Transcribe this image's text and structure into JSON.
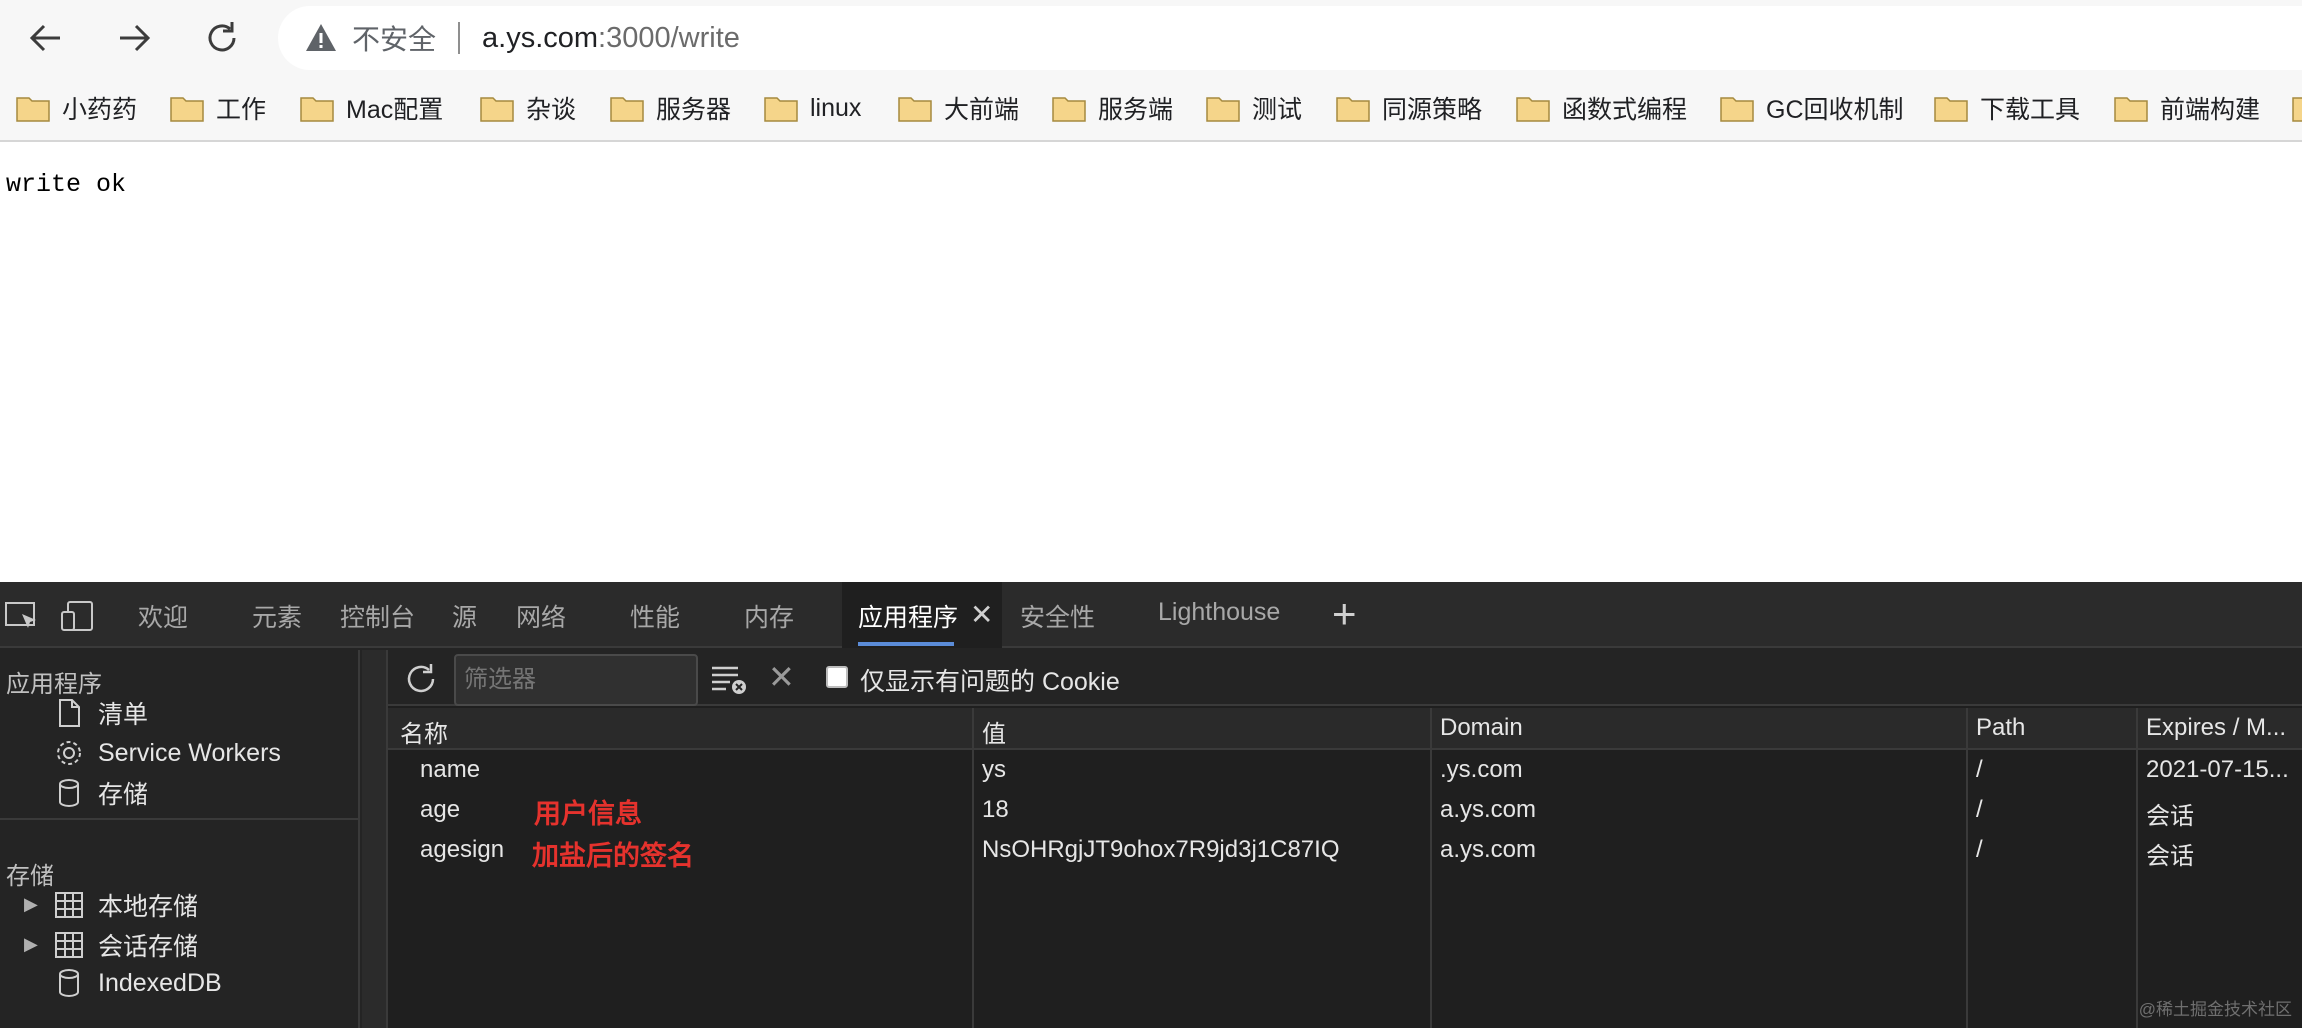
{
  "browser": {
    "security_label": "不安全",
    "url_host": "a.ys.com",
    "url_rest": ":3000/write",
    "icons": [
      "back-arrow-icon",
      "forward-arrow-icon",
      "reload-icon",
      "warning-icon",
      "folder-icon"
    ]
  },
  "bookmarks": [
    {
      "label": "小药药"
    },
    {
      "label": "工作"
    },
    {
      "label": "Mac配置"
    },
    {
      "label": "杂谈"
    },
    {
      "label": "服务器"
    },
    {
      "label": "linux"
    },
    {
      "label": "大前端"
    },
    {
      "label": "服务端"
    },
    {
      "label": "测试"
    },
    {
      "label": "同源策略"
    },
    {
      "label": "函数式编程"
    },
    {
      "label": "GC回收机制"
    },
    {
      "label": "下载工具"
    },
    {
      "label": "前端构建"
    }
  ],
  "page": {
    "text": "write ok"
  },
  "devtools": {
    "tabs": [
      "欢迎",
      "元素",
      "控制台",
      "源",
      "网络",
      "性能",
      "内存",
      "应用程序",
      "安全性",
      "Lighthouse"
    ],
    "active_tab": "应用程序",
    "sidebar": {
      "app_heading": "应用程序",
      "app_items": [
        "清单",
        "Service Workers",
        "存储"
      ],
      "storage_heading": "存储",
      "storage_items": [
        "本地存储",
        "会话存储",
        "IndexedDB"
      ]
    },
    "cookies": {
      "filter_placeholder": "筛选器",
      "only_issues_label": "仅显示有问题的 Cookie",
      "columns": [
        "名称",
        "值",
        "Domain",
        "Path",
        "Expires / M..."
      ],
      "rows": [
        {
          "name": "name",
          "value": "ys",
          "domain": ".ys.com",
          "path": "/",
          "expires": "2021-07-15..."
        },
        {
          "name": "age",
          "value": "18",
          "domain": "a.ys.com",
          "path": "/",
          "expires": "会话"
        },
        {
          "name": "agesign",
          "value": "NsOHRgjJT9ohox7R9jd3j1C87IQ",
          "domain": "a.ys.com",
          "path": "/",
          "expires": "会话"
        }
      ],
      "annotations": [
        "用户信息",
        "加盐后的签名"
      ]
    }
  },
  "watermark": "@稀土掘金技术社区",
  "colors": {
    "annotation": "#e5322d",
    "active_tab_underline": "#5b8cd8",
    "devtools_bg": "#242424"
  }
}
